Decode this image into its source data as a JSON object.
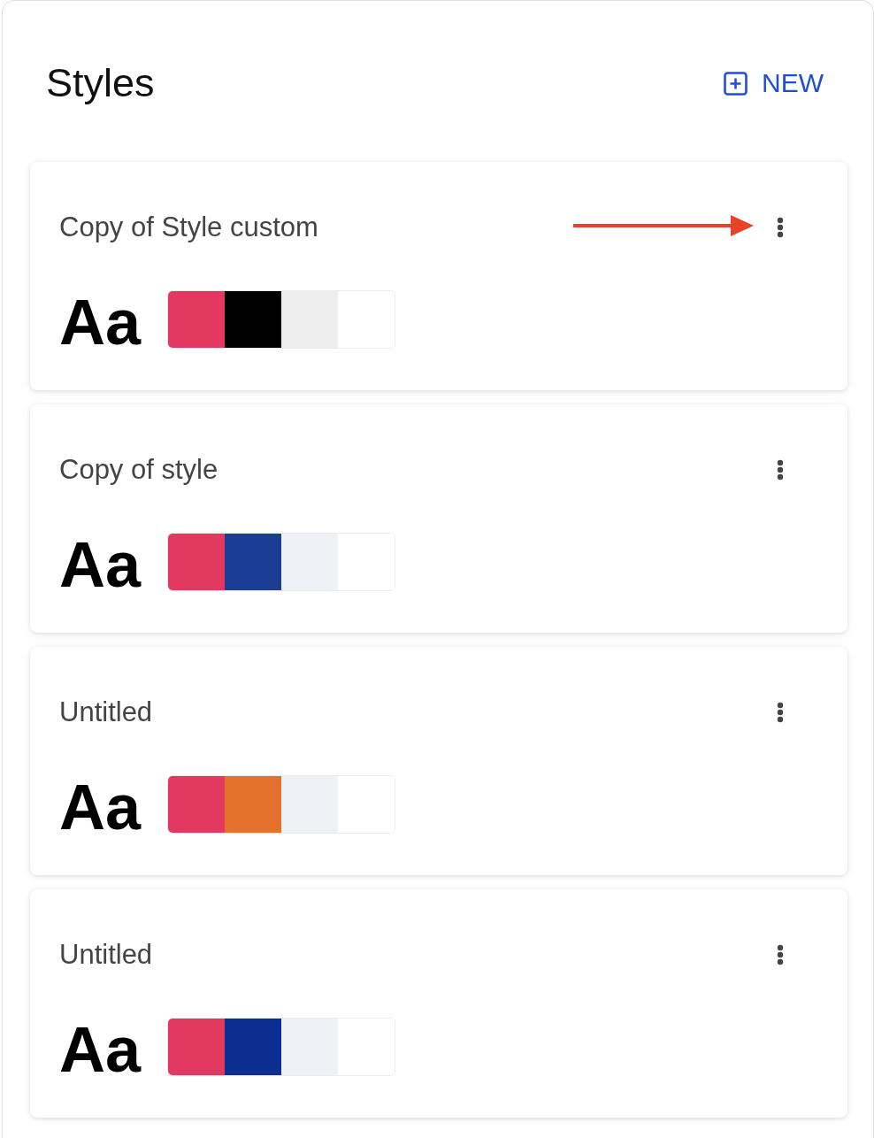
{
  "panel": {
    "title": "Styles",
    "new_button": {
      "label": "NEW"
    }
  },
  "styles": [
    {
      "name": "Copy of Style custom",
      "preview": "Aa",
      "pointer_arrow": true,
      "swatches": [
        {
          "color": "#e3385f"
        },
        {
          "color": "#000000"
        },
        {
          "color": "#eeeeee"
        },
        {
          "color": "#ffffff"
        }
      ]
    },
    {
      "name": "Copy of style",
      "preview": "Aa",
      "pointer_arrow": false,
      "swatches": [
        {
          "color": "#e3385f"
        },
        {
          "color": "#1b3d94"
        },
        {
          "color": "#eef2f7"
        },
        {
          "color": "#ffffff"
        }
      ]
    },
    {
      "name": "Untitled",
      "preview": "Aa",
      "pointer_arrow": false,
      "swatches": [
        {
          "color": "#e3385f"
        },
        {
          "color": "#e4722e"
        },
        {
          "color": "#eef2f7"
        },
        {
          "color": "#ffffff"
        }
      ]
    },
    {
      "name": "Untitled",
      "preview": "Aa",
      "pointer_arrow": false,
      "swatches": [
        {
          "color": "#e3385f"
        },
        {
          "color": "#0c2d91"
        },
        {
          "color": "#eef2f7"
        },
        {
          "color": "#ffffff"
        }
      ]
    }
  ]
}
